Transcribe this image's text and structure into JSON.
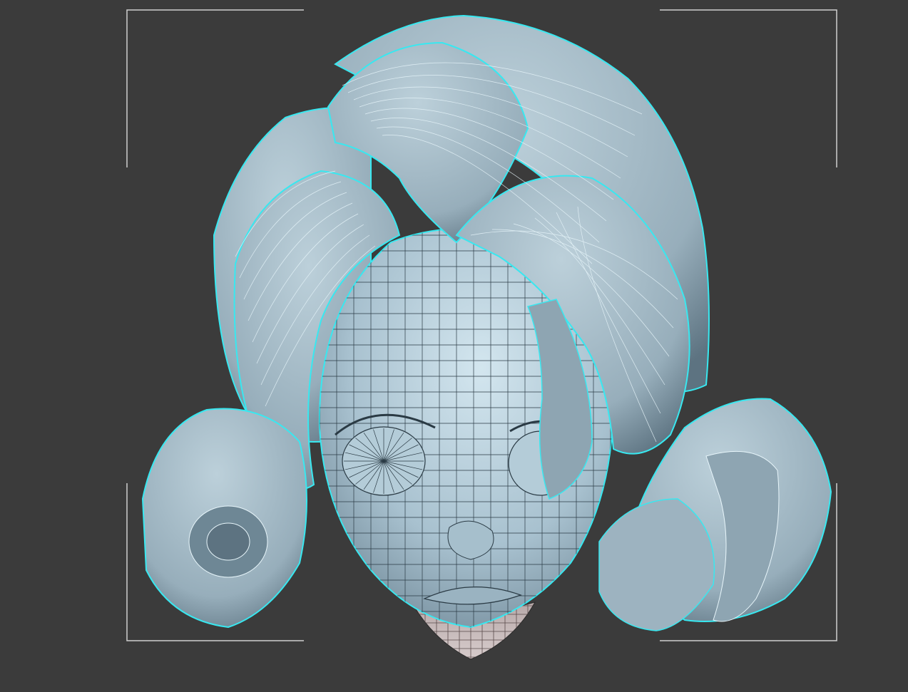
{
  "viewport": {
    "background": "#3b3b3b",
    "bracket_color": "#cfcfcf",
    "selection_color": "#38e8f0",
    "wire_color": "#e8f6fb",
    "face_wire_color": "#2a3a44"
  },
  "model": {
    "hair_fill": "#9db3c0",
    "hair_shadow": "#5d7381",
    "face_fill": "#bdd4e0",
    "neck_fill": "#c9bcbc",
    "selected": true
  },
  "icons": {
    "selection_brackets": "selection-bracket-icon"
  }
}
